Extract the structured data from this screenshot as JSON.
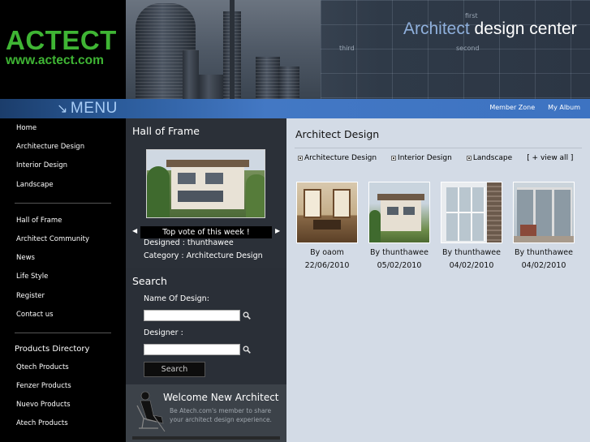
{
  "logo": {
    "name": "ACTECT",
    "url": "www.actect.com"
  },
  "banner": {
    "title_part1": "Architect",
    "title_part2": "design center",
    "grid_words": [
      "first",
      "third",
      "second"
    ]
  },
  "menubar": {
    "menu_label": "MENU",
    "menu_icon": "arrow-down-right-icon",
    "links": [
      "Member Zone",
      "My Album"
    ]
  },
  "sidebar": {
    "group1": [
      "Home",
      "Architecture Design",
      "Interior Design",
      "Landscape"
    ],
    "group2": [
      "Hall of Frame",
      "Architect Community",
      "News",
      "Life Style",
      "Register",
      "Contact us"
    ],
    "products_heading": "Products Directory",
    "group3": [
      "Qtech Products",
      "Fenzer Products",
      "Nuevo Products",
      "Atech Products"
    ]
  },
  "hall": {
    "title": "Hall of Frame",
    "vote_label": "Top vote of this week !",
    "designed": "Designed : thunthawee",
    "category": "Category : Architecture Design"
  },
  "search": {
    "title": "Search",
    "name_label": "Name Of Design:",
    "designer_label": "Designer :",
    "name_value": "",
    "designer_value": "",
    "button": "Search"
  },
  "welcome": {
    "title": "Welcome New Architect",
    "text": "Be Atech.com's member to share your architect design experience."
  },
  "content": {
    "title": "Architect Design",
    "categories": [
      "Architecture Design",
      "Interior Design",
      "Landscape"
    ],
    "view_all": "[ + view all ]",
    "items": [
      {
        "by": "By oaom",
        "date": "22/06/2010"
      },
      {
        "by": "By thunthawee",
        "date": "05/02/2010"
      },
      {
        "by": "By thunthawee",
        "date": "04/02/2010"
      },
      {
        "by": "By thunthawee",
        "date": "04/02/2010"
      }
    ]
  },
  "colors": {
    "logo_green": "#3fb534",
    "menu_blue": "#4378c4",
    "content_bg": "#d3dbe6",
    "sidebar_bg": "#000000"
  }
}
